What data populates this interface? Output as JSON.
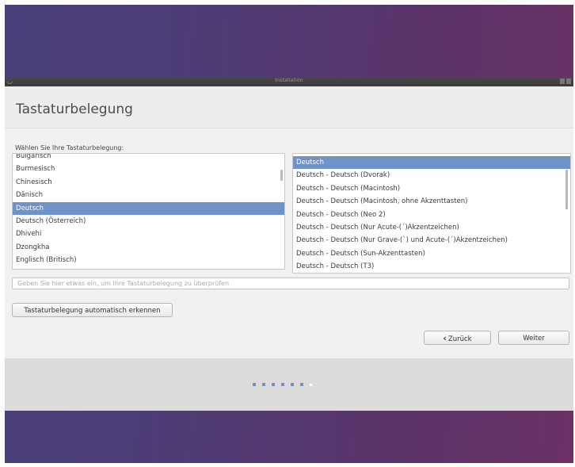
{
  "window": {
    "title": "Installation"
  },
  "page": {
    "title": "Tastaturbelegung",
    "prompt": "Wählen Sie Ihre Tastaturbelegung:"
  },
  "layouts": [
    {
      "label": "Bulgarisch",
      "selected": false
    },
    {
      "label": "Burmesisch",
      "selected": false
    },
    {
      "label": "Chinesisch",
      "selected": false
    },
    {
      "label": "Dänisch",
      "selected": false
    },
    {
      "label": "Deutsch",
      "selected": true
    },
    {
      "label": "Deutsch (Österreich)",
      "selected": false
    },
    {
      "label": "Dhivehi",
      "selected": false
    },
    {
      "label": "Dzongkha",
      "selected": false
    },
    {
      "label": "Englisch (Britisch)",
      "selected": false
    }
  ],
  "variants": [
    {
      "label": "Deutsch",
      "selected": true
    },
    {
      "label": "Deutsch - Deutsch (Dvorak)",
      "selected": false
    },
    {
      "label": "Deutsch - Deutsch (Macintosh)",
      "selected": false
    },
    {
      "label": "Deutsch - Deutsch (Macintosh, ohne Akzenttasten)",
      "selected": false
    },
    {
      "label": "Deutsch - Deutsch (Neo 2)",
      "selected": false
    },
    {
      "label": "Deutsch - Deutsch (Nur Acute-(´)Akzentzeichen)",
      "selected": false
    },
    {
      "label": "Deutsch - Deutsch (Nur Grave-(`) und Acute-(´)Akzentzeichen)",
      "selected": false
    },
    {
      "label": "Deutsch - Deutsch (Sun-Akzenttasten)",
      "selected": false
    },
    {
      "label": "Deutsch - Deutsch (T3)",
      "selected": false
    }
  ],
  "test_input": {
    "placeholder": "Geben Sie hier etwas ein, um Ihre Tastaturbelegung zu überprüfen",
    "value": ""
  },
  "buttons": {
    "detect": "Tastaturbelegung automatisch erkennen",
    "back": "Zurück",
    "next": "Weiter"
  },
  "progress": {
    "total_steps": 7,
    "current_step": 7
  },
  "colors": {
    "selection": "#6f93c8",
    "step_done": "#6f93c8",
    "step_current": "#ffffff"
  }
}
